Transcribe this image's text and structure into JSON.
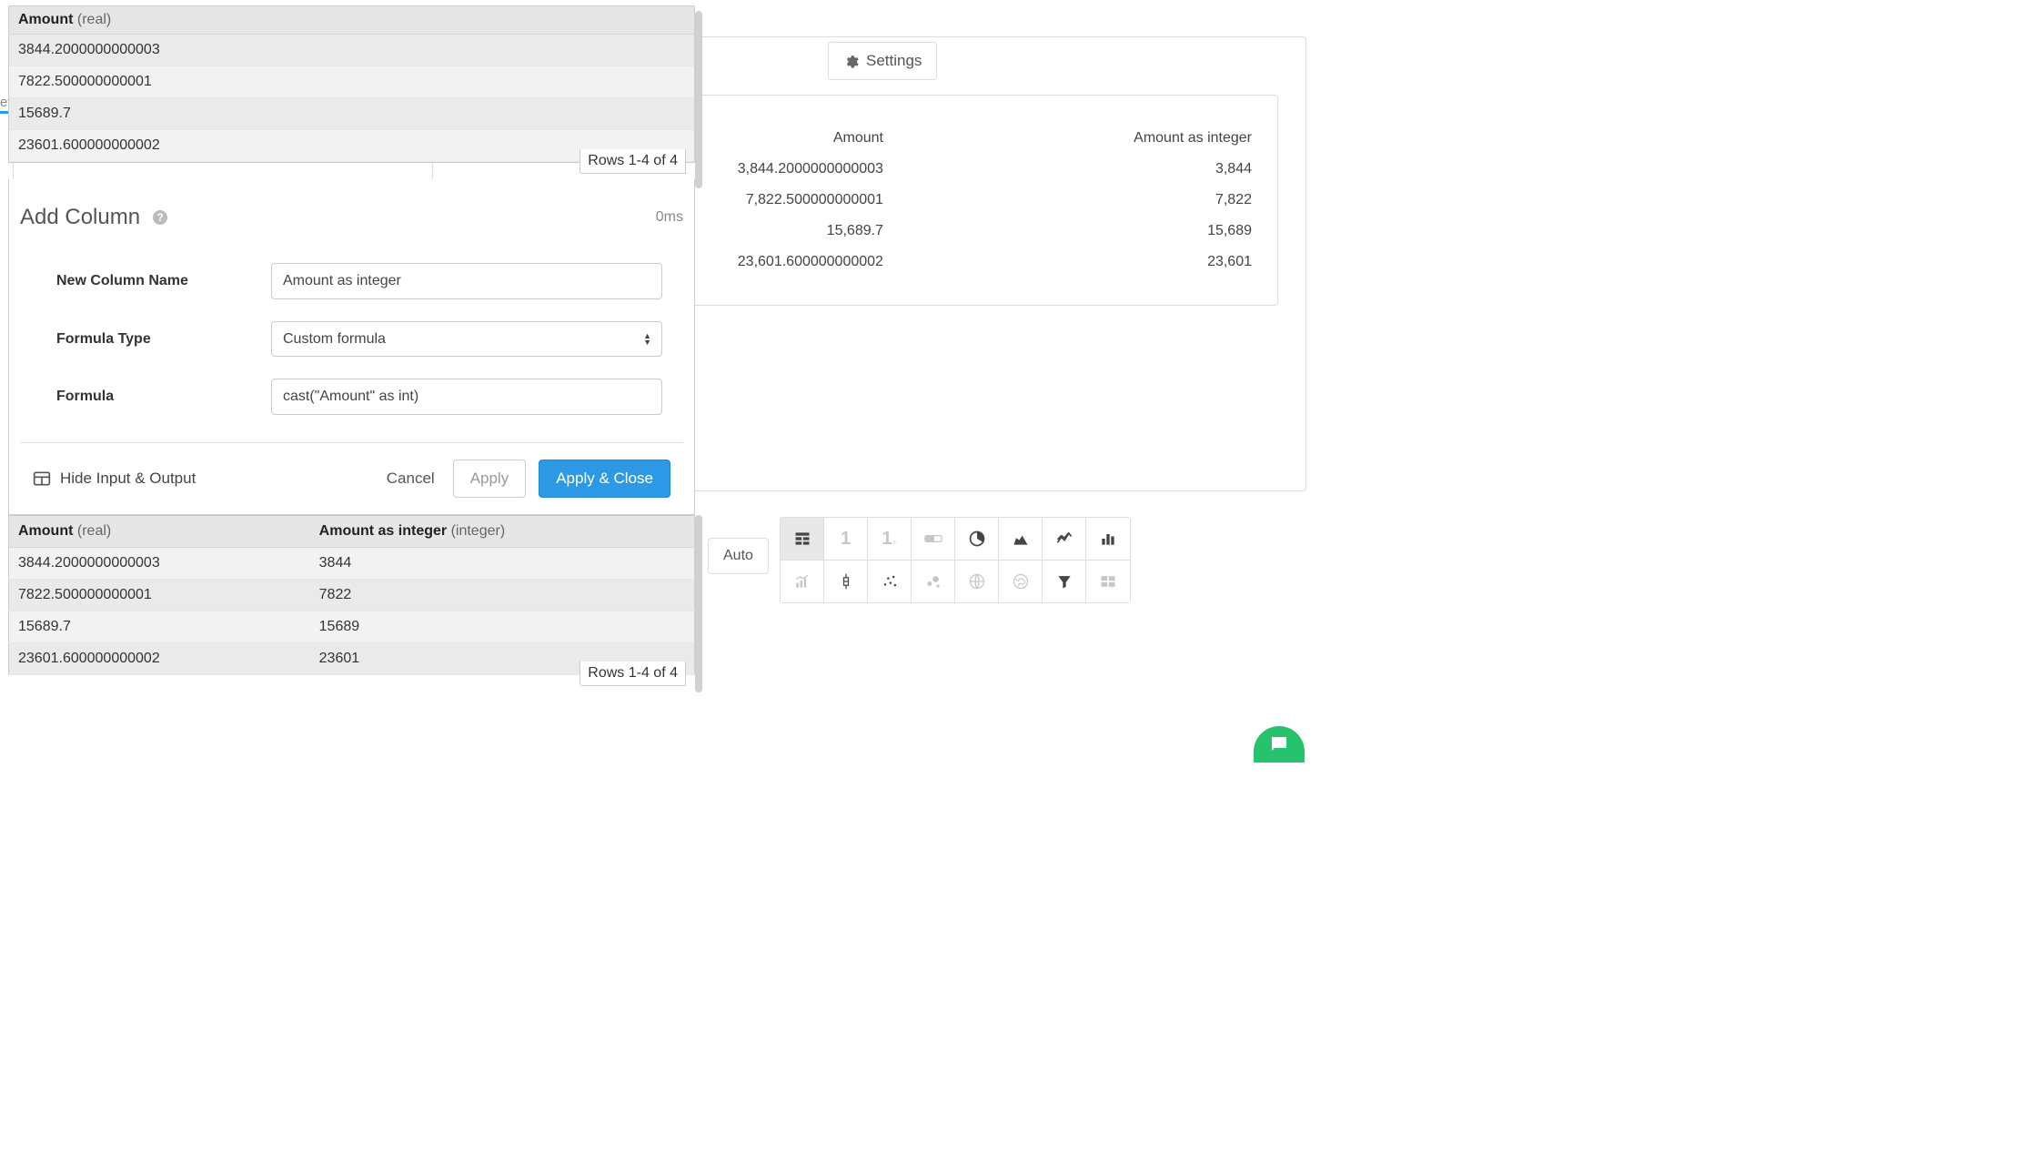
{
  "settings_label": "Settings",
  "auto_label": "Auto",
  "partial_label": "ev",
  "right_table": {
    "headers": [
      "Amount",
      "Amount as integer"
    ],
    "rows": [
      [
        "3,844.2000000000003",
        "3,844"
      ],
      [
        "7,822.500000000001",
        "7,822"
      ],
      [
        "15,689.7",
        "15,689"
      ],
      [
        "23,601.600000000002",
        "23,601"
      ]
    ]
  },
  "input_preview": {
    "col_name": "Amount",
    "col_type": "(real)",
    "rows": [
      "3844.2000000000003",
      "7822.500000000001",
      "15689.7",
      "23601.600000000002"
    ],
    "counter": "Rows 1-4 of 4"
  },
  "dialog": {
    "title": "Add Column",
    "elapsed": "0ms",
    "labels": {
      "name": "New Column Name",
      "type": "Formula Type",
      "formula": "Formula"
    },
    "name_value": "Amount as integer",
    "type_value": "Custom formula",
    "formula_value": "cast(\"Amount\" as int)",
    "hide_io": "Hide Input & Output",
    "cancel": "Cancel",
    "apply": "Apply",
    "apply_close": "Apply & Close"
  },
  "output_preview": {
    "col1_name": "Amount",
    "col1_type": "(real)",
    "col2_name": "Amount as integer",
    "col2_type": "(integer)",
    "rows": [
      [
        "3844.2000000000003",
        "3844"
      ],
      [
        "7822.500000000001",
        "7822"
      ],
      [
        "15689.7",
        "15689"
      ],
      [
        "23601.600000000002",
        "23601"
      ]
    ],
    "counter": "Rows 1-4 of 4"
  }
}
